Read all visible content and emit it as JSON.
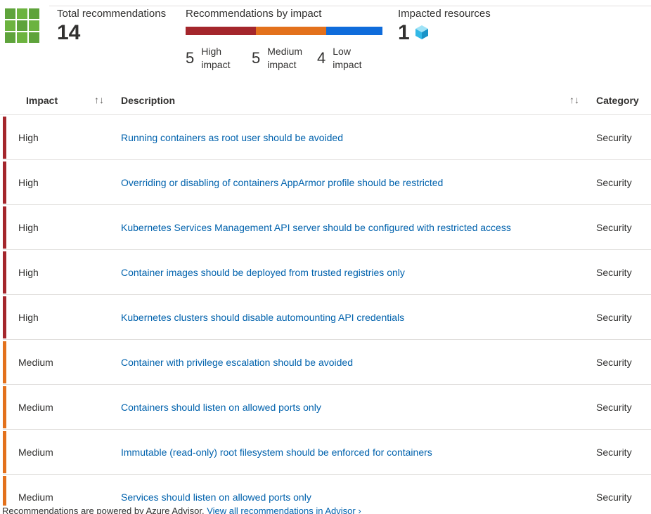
{
  "colors": {
    "high": "#a4262c",
    "medium": "#e3711c",
    "low": "#0f6cdb",
    "link": "#0062ad"
  },
  "summary": {
    "total_label": "Total recommendations",
    "total_value": "14",
    "by_impact_label": "Recommendations by impact",
    "impact_distribution": {
      "high": 5,
      "medium": 5,
      "low": 4
    },
    "high": {
      "count": "5",
      "line1": "High",
      "line2": "impact"
    },
    "medium": {
      "count": "5",
      "line1": "Medium",
      "line2": "impact"
    },
    "low": {
      "count": "4",
      "line1": "Low",
      "line2": "impact"
    },
    "resources_label": "Impacted resources",
    "resources_value": "1",
    "resources_icon": "kubernetes-cube-icon"
  },
  "table": {
    "columns": {
      "impact": "Impact",
      "description": "Description",
      "category": "Category"
    },
    "sort_icon": "↑↓",
    "rows": [
      {
        "impact": "High",
        "level": "high",
        "description": "Running containers as root user should be avoided",
        "category": "Security"
      },
      {
        "impact": "High",
        "level": "high",
        "description": "Overriding or disabling of containers AppArmor profile should be restricted",
        "category": "Security"
      },
      {
        "impact": "High",
        "level": "high",
        "description": "Kubernetes Services Management API server should be configured with restricted access",
        "category": "Security"
      },
      {
        "impact": "High",
        "level": "high",
        "description": "Container images should be deployed from trusted registries only",
        "category": "Security"
      },
      {
        "impact": "High",
        "level": "high",
        "description": "Kubernetes clusters should disable automounting API credentials",
        "category": "Security"
      },
      {
        "impact": "Medium",
        "level": "medium",
        "description": "Container with privilege escalation should be avoided",
        "category": "Security"
      },
      {
        "impact": "Medium",
        "level": "medium",
        "description": "Containers should listen on allowed ports only",
        "category": "Security"
      },
      {
        "impact": "Medium",
        "level": "medium",
        "description": "Immutable (read-only) root filesystem should be enforced for containers",
        "category": "Security"
      },
      {
        "impact": "Medium",
        "level": "medium",
        "description": "Services should listen on allowed ports only",
        "category": "Security"
      }
    ]
  },
  "footer": {
    "text": "Recommendations are powered by Azure Advisor.",
    "link": "View all recommendations in Advisor",
    "chevron": "›"
  }
}
